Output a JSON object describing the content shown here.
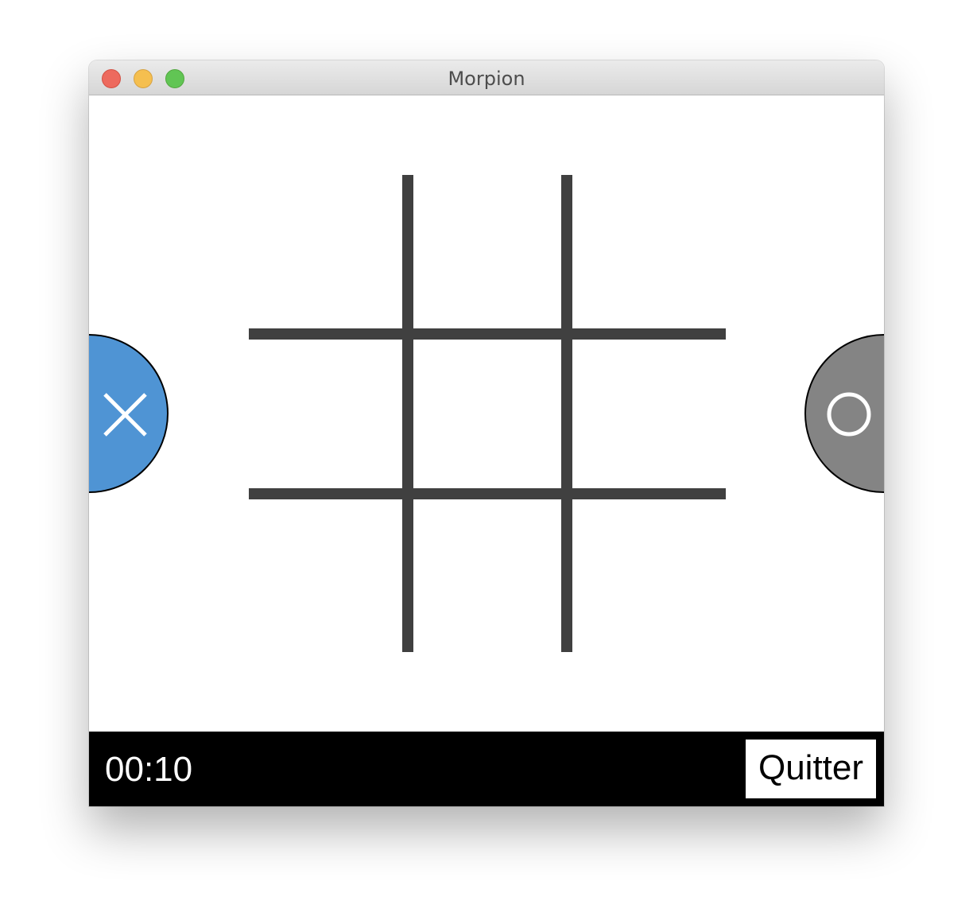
{
  "window": {
    "title": "Morpion",
    "controls": [
      "close",
      "minimize",
      "zoom"
    ]
  },
  "game": {
    "board": {
      "rows": 3,
      "cols": 3,
      "cells": [
        "",
        "",
        "",
        "",
        "",
        "",
        "",
        "",
        ""
      ],
      "line_color": "#404040"
    },
    "players": [
      {
        "symbol_icon": "x-icon",
        "color": "#4f94d4",
        "side": "left"
      },
      {
        "symbol_icon": "o-icon",
        "color": "#848484",
        "side": "right"
      }
    ]
  },
  "footer": {
    "timer": "00:10",
    "quit_label": "Quitter"
  }
}
